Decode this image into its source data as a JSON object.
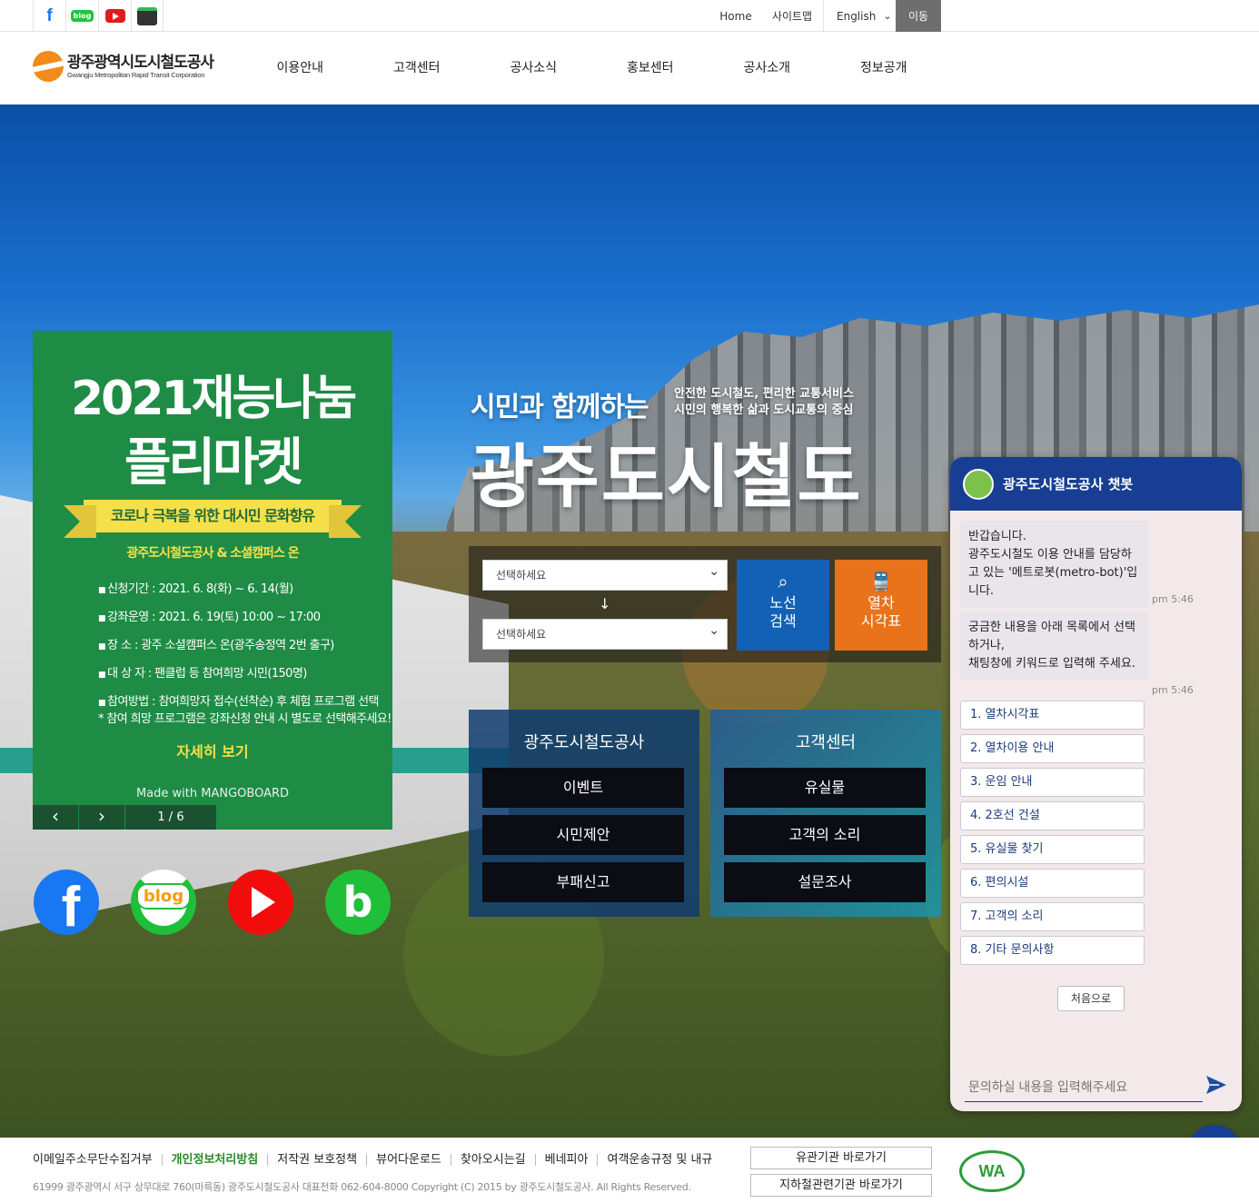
{
  "top": {
    "sns": [
      "facebook-icon",
      "blog-icon",
      "youtube-icon",
      "band-icon"
    ],
    "home": "Home",
    "sitemap": "사이트맵",
    "language": "English",
    "go": "이동"
  },
  "header": {
    "logo_ko": "광주광역시도시철도공사",
    "logo_en": "Gwangju Metropolitan Rapid Transit Corporation",
    "nav": [
      "이용안내",
      "고객센터",
      "공사소식",
      "홍보센터",
      "공사소개",
      "정보공개"
    ]
  },
  "promo": {
    "title1": "2021재능나눔",
    "title2": "플리마켓",
    "ribbon": "코로나 극복을 위한 대시민 문화향유",
    "org": "광주도시철도공사 & 소셜캠퍼스 온",
    "items": [
      "신청기간 : 2021. 6. 8(화) ~ 6. 14(월)",
      "강좌운영 : 2021. 6. 19(토) 10:00 ~ 17:00",
      "장    소 : 광주 소셜캠퍼스 온(광주송정역 2번 출구)",
      "대 상 자 : 팬클럽 등 참여희망 시민(150명)",
      "참여방법 : 참여희망자 접수(선착순) 후 체험 프로그램 선택"
    ],
    "note": "* 참여 희망 프로그램은 강좌신청 안내 시 별도로 선택해주세요!",
    "more": "자세히 보기",
    "made_with": "Made with MANGOBOARD",
    "prev": "‹",
    "next": "›",
    "page": "1 / 6"
  },
  "sns_big": {
    "facebook": "f",
    "blog": "blog",
    "band": "b"
  },
  "slogan": {
    "line1": "시민과 함께하는",
    "sub1": "안전한 도시철도, 편리한 교통서비스",
    "sub2": "시민의 행복한 삶과 도시교통의 중심",
    "main": "광주도시철도"
  },
  "route": {
    "from_placeholder": "선택하세요",
    "to_placeholder": "선택하세요",
    "line_search": "노선\n검색",
    "timetable": "열차\n시각표"
  },
  "quick": {
    "left_title": "광주도시철도공사",
    "left_items": [
      "이벤트",
      "시민제안",
      "부패신고"
    ],
    "right_title": "고객센터",
    "right_items": [
      "유실물",
      "고객의 소리",
      "설문조사"
    ]
  },
  "chat": {
    "title": "광주도시철도공사 챗봇",
    "msg1": "반갑습니다.\n광주도시철도 이용 안내를 담당하고 있는 '메트로봇(metro-bot)'입니다.",
    "time1": "pm 5:46",
    "msg2": "궁금한 내용을 아래 목록에서 선택하거나,\n채팅창에 키워드로 입력해 주세요.",
    "time2": "pm 5:46",
    "options": [
      "1. 열차시각표",
      "2. 열차이용 안내",
      "3. 운임 안내",
      "4. 2호선 건설",
      "5. 유실물 찾기",
      "6. 편의시설",
      "7. 고객의 소리",
      "8. 기타 문의사항"
    ],
    "home_button": "처음으로",
    "input_placeholder": "문의하실 내용을 입력해주세요",
    "close": "✕"
  },
  "footer": {
    "links": [
      "이메일주소무단수집거부",
      "개인정보처리방침",
      "저작권 보호정책",
      "뷰어다운로드",
      "찾아오시는길",
      "베네피아",
      "여객운송규정 및 내규"
    ],
    "address": "61999 광주광역시 서구 상무대로 760(마륵동) 광주도시철도공사 대표전화 062-604-8000 Copyright (C) 2015 by 광주도시철도공사. All Rights Reserved.",
    "btn1": "유관기관 바로가기",
    "btn2": "지하철관련기관 바로가기",
    "wa_mark": "WA"
  }
}
